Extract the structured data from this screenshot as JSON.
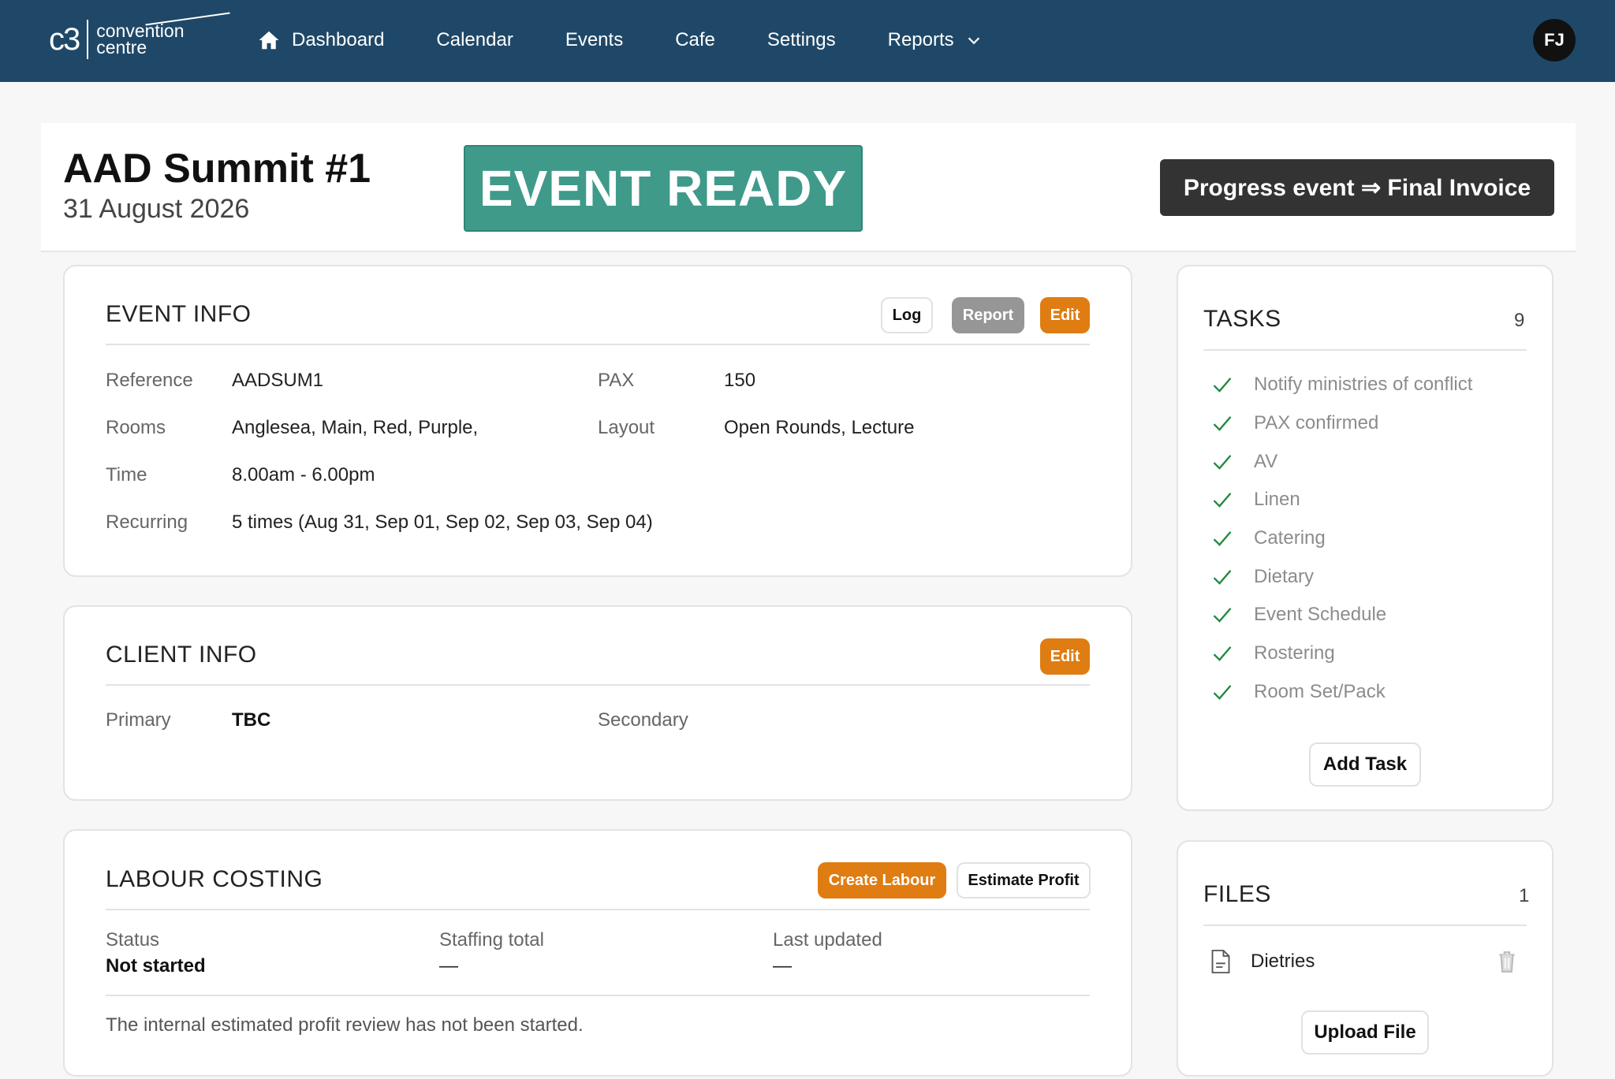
{
  "nav": {
    "logo_mark": "c3",
    "logo_line1": "convention",
    "logo_line2": "centre",
    "items": [
      {
        "label": "Dashboard",
        "icon": "home-icon"
      },
      {
        "label": "Calendar"
      },
      {
        "label": "Events"
      },
      {
        "label": "Cafe"
      },
      {
        "label": "Settings"
      },
      {
        "label": "Reports",
        "icon": "chevron-down-icon"
      }
    ],
    "avatar_initials": "FJ"
  },
  "event": {
    "title": "AAD Summit #1",
    "date": "31 August 2026",
    "status": "EVENT READY",
    "progress_label": "Progress event ⇒ Final Invoice"
  },
  "event_info": {
    "title": "EVENT INFO",
    "buttons": {
      "log": "Log",
      "report": "Report",
      "edit": "Edit"
    },
    "fields": {
      "reference_label": "Reference",
      "reference": "AADSUM1",
      "pax_label": "PAX",
      "pax": "150",
      "rooms_label": "Rooms",
      "rooms": "Anglesea, Main, Red, Purple,",
      "layout_label": "Layout",
      "layout": "Open Rounds, Lecture",
      "time_label": "Time",
      "time": "8.00am - 6.00pm",
      "recurring_label": "Recurring",
      "recurring": "5 times (Aug 31, Sep 01, Sep 02, Sep 03, Sep 04)"
    }
  },
  "client_info": {
    "title": "CLIENT INFO",
    "edit": "Edit",
    "primary_label": "Primary",
    "primary": "TBC",
    "secondary_label": "Secondary"
  },
  "labour": {
    "title": "LABOUR COSTING",
    "create_label": "Create Labour",
    "estimate_label": "Estimate Profit",
    "status_label": "Status",
    "status": "Not started",
    "staffing_label": "Staffing total",
    "staffing": "—",
    "updated_label": "Last updated",
    "updated": "—",
    "note": "The internal estimated profit review has not been started."
  },
  "tasks": {
    "title": "TASKS",
    "count": "9",
    "items": [
      "Notify ministries of conflict",
      "PAX confirmed",
      "AV",
      "Linen",
      "Catering",
      "Dietary",
      "Event Schedule",
      "Rostering",
      "Room Set/Pack"
    ],
    "add_label": "Add Task",
    "check_color": "#1e8a3c"
  },
  "files": {
    "title": "FILES",
    "count": "1",
    "items": [
      "Dietries"
    ],
    "upload_label": "Upload File"
  },
  "colors": {
    "nav_bg": "#1f4868",
    "status_bg": "#3f9a8a",
    "orange": "#df7c12",
    "dark_button": "#333333"
  }
}
